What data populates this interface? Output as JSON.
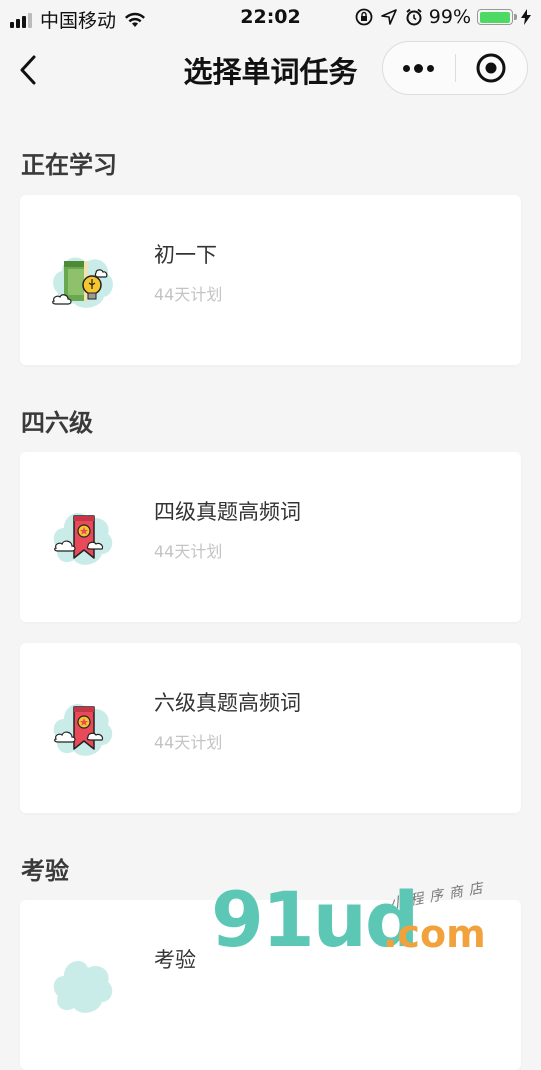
{
  "status_bar": {
    "carrier": "中国移动",
    "time": "22:02",
    "battery_percent": "99%",
    "battery_level": 0.99
  },
  "nav": {
    "title": "选择单词任务"
  },
  "sections": [
    {
      "title": "正在学习",
      "cards": [
        {
          "name": "初一下",
          "subtitle": "44天计划",
          "icon": "book-bulb-icon"
        }
      ]
    },
    {
      "title": "四六级",
      "cards": [
        {
          "name": "四级真题高频词",
          "subtitle": "44天计划",
          "icon": "ribbon-badge-icon"
        },
        {
          "name": "六级真题高频词",
          "subtitle": "44天计划",
          "icon": "ribbon-badge-icon"
        }
      ]
    },
    {
      "title": "考验",
      "cards": [
        {
          "name": "考验",
          "subtitle": "",
          "icon": "ribbon-badge-icon"
        }
      ]
    }
  ],
  "watermark": {
    "main": "91ud",
    "suffix": ".com",
    "tagline": "小程序商店"
  },
  "colors": {
    "accent_teal": "#5cc7b5",
    "accent_orange": "#f2a23c",
    "battery_green": "#4cd964",
    "ribbon_red": "#e94a5a"
  }
}
